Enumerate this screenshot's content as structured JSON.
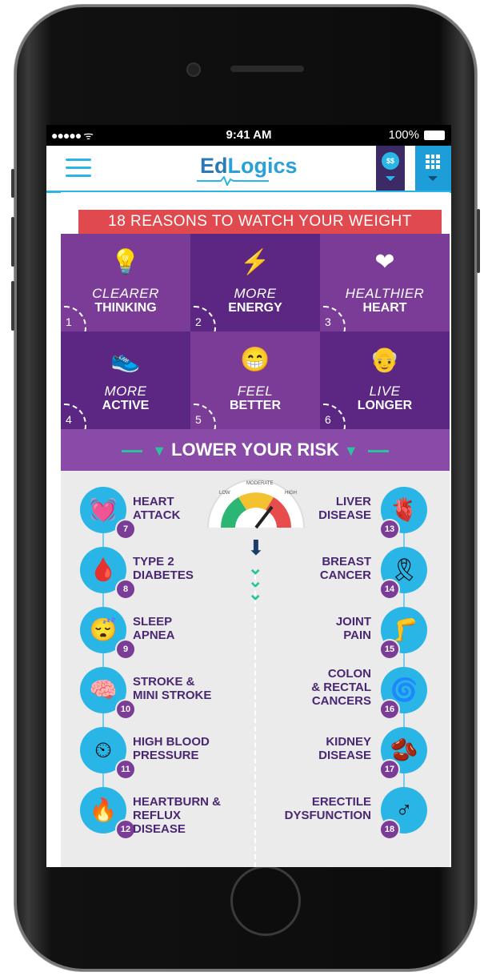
{
  "status": {
    "signal": "●●●●● ᯤ",
    "time": "9:41 AM",
    "battery": "100%"
  },
  "app": {
    "logo_ed": "Ed",
    "logo_logics": "Logics",
    "coin_label": "$$"
  },
  "banner": {
    "title": "18 REASONS TO WATCH YOUR WEIGHT"
  },
  "reasons": [
    {
      "n": "1",
      "line1": "CLEARER",
      "line2": "THINKING",
      "icon": "lightbulb-icon",
      "glyph": "💡"
    },
    {
      "n": "2",
      "line1": "MORE",
      "line2": "ENERGY",
      "icon": "lightning-icon",
      "glyph": "⚡"
    },
    {
      "n": "3",
      "line1": "HEALTHIER",
      "line2": "HEART",
      "icon": "heart-icon",
      "glyph": "❤"
    },
    {
      "n": "4",
      "line1": "MORE",
      "line2": "ACTIVE",
      "icon": "sneaker-icon",
      "glyph": "👟"
    },
    {
      "n": "5",
      "line1": "FEEL",
      "line2": "BETTER",
      "icon": "smiley-icon",
      "glyph": "😁"
    },
    {
      "n": "6",
      "line1": "LIVE",
      "line2": "LONGER",
      "icon": "elderly-couple-icon",
      "glyph": "👴"
    }
  ],
  "risk": {
    "title": "LOWER YOUR RISK",
    "gauge": [
      "LOW",
      "MODERATE",
      "HIGH"
    ]
  },
  "risks_left": [
    {
      "n": "7",
      "l1": "HEART",
      "l2": "ATTACK",
      "icon": "heart-monitor-icon",
      "glyph": "💓"
    },
    {
      "n": "8",
      "l1": "TYPE 2",
      "l2": "DIABETES",
      "icon": "glucose-meter-icon",
      "glyph": "🩸"
    },
    {
      "n": "9",
      "l1": "SLEEP",
      "l2": "APNEA",
      "icon": "sleep-icon",
      "glyph": "😴"
    },
    {
      "n": "10",
      "l1": "STROKE &",
      "l2": "MINI STROKE",
      "icon": "brain-icon",
      "glyph": "🧠"
    },
    {
      "n": "11",
      "l1": "HIGH BLOOD",
      "l2": "PRESSURE",
      "icon": "blood-pressure-icon",
      "glyph": "⏲"
    },
    {
      "n": "12",
      "l1": "HEARTBURN &",
      "l2": "REFLUX DISEASE",
      "icon": "stomach-icon",
      "glyph": "🔥"
    }
  ],
  "risks_right": [
    {
      "n": "13",
      "l1": "LIVER",
      "l2": "DISEASE",
      "l3": "",
      "icon": "liver-icon",
      "glyph": "🫀"
    },
    {
      "n": "14",
      "l1": "BREAST",
      "l2": "CANCER",
      "l3": "",
      "icon": "pink-ribbon-icon",
      "glyph": "🎗"
    },
    {
      "n": "15",
      "l1": "JOINT",
      "l2": "PAIN",
      "l3": "",
      "icon": "knee-joint-icon",
      "glyph": "🦵"
    },
    {
      "n": "16",
      "l1": "COLON",
      "l2": "& RECTAL",
      "l3": "CANCERS",
      "icon": "colon-icon",
      "glyph": "🌀"
    },
    {
      "n": "17",
      "l1": "KIDNEY",
      "l2": "DISEASE",
      "l3": "",
      "icon": "kidney-icon",
      "glyph": "🫘"
    },
    {
      "n": "18",
      "l1": "ERECTILE",
      "l2": "DYSFUNCTION",
      "l3": "",
      "icon": "male-symbol-icon",
      "glyph": "♂"
    }
  ]
}
